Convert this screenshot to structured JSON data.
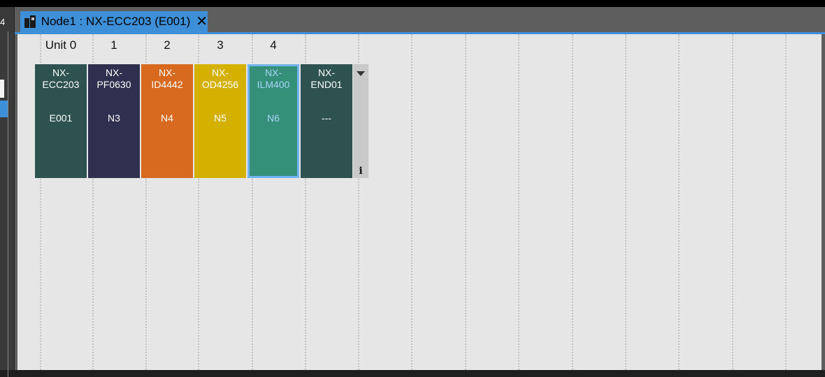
{
  "window": {
    "tab": {
      "title": "Node1 : NX-ECC203 (E001)",
      "icon": "device-icon",
      "close_icon": "✕"
    }
  },
  "left_panel": {
    "glyph": "4"
  },
  "units": [
    {
      "label": "Unit 0",
      "model": "NX-\nECC203",
      "node": "E001",
      "color": "#2d5250"
    },
    {
      "label": "1",
      "model": "NX-\nPF0630",
      "node": "N3",
      "color": "#2f2f4f"
    },
    {
      "label": "2",
      "model": "NX-\nID4442",
      "node": "N4",
      "color": "#d86a20"
    },
    {
      "label": "3",
      "model": "NX-\nOD4256",
      "node": "N5",
      "color": "#d4b000"
    },
    {
      "label": "4",
      "model": "NX-\nILM400",
      "node": "N6",
      "color": "#35907a",
      "selected": true
    },
    {
      "label": "",
      "model": "NX-\nEND01",
      "node": "---",
      "color": "#2d5250"
    }
  ],
  "scroller": {
    "arrow_icon": "chevron-down-icon",
    "info_label": "i"
  }
}
